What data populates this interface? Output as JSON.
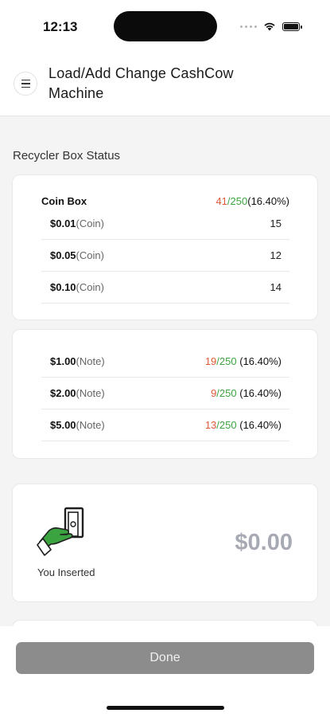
{
  "status_bar": {
    "time": "12:13"
  },
  "header": {
    "title": "Load/Add Change CashCow Machine"
  },
  "section": {
    "title": "Recycler Box Status"
  },
  "coin_box": {
    "label": "Coin Box",
    "current": "41",
    "capacity": "250",
    "percent": "(16.40%)",
    "rows": [
      {
        "amount": "$0.01",
        "kind": "(Coin)",
        "count": "15"
      },
      {
        "amount": "$0.05",
        "kind": "(Coin)",
        "count": "12"
      },
      {
        "amount": "$0.10",
        "kind": "(Coin)",
        "count": "14"
      }
    ]
  },
  "notes": {
    "rows": [
      {
        "amount": "$1.00",
        "kind": "(Note)",
        "current": "19",
        "capacity": "250",
        "percent": "(16.40%)"
      },
      {
        "amount": "$2.00",
        "kind": "(Note)",
        "current": "9",
        "capacity": "250",
        "percent": "(16.40%)"
      },
      {
        "amount": "$5.00",
        "kind": "(Note)",
        "current": "13",
        "capacity": "250",
        "percent": "(16.40%)"
      }
    ]
  },
  "inserted": {
    "label": "You Inserted",
    "amount": "$0.00",
    "icon": "cash-insert-icon"
  },
  "actions": {
    "done_label": "Done"
  },
  "colors": {
    "accent_green": "#3ba440",
    "accent_red": "#e0583a",
    "button_gray": "#8c8c8c"
  }
}
